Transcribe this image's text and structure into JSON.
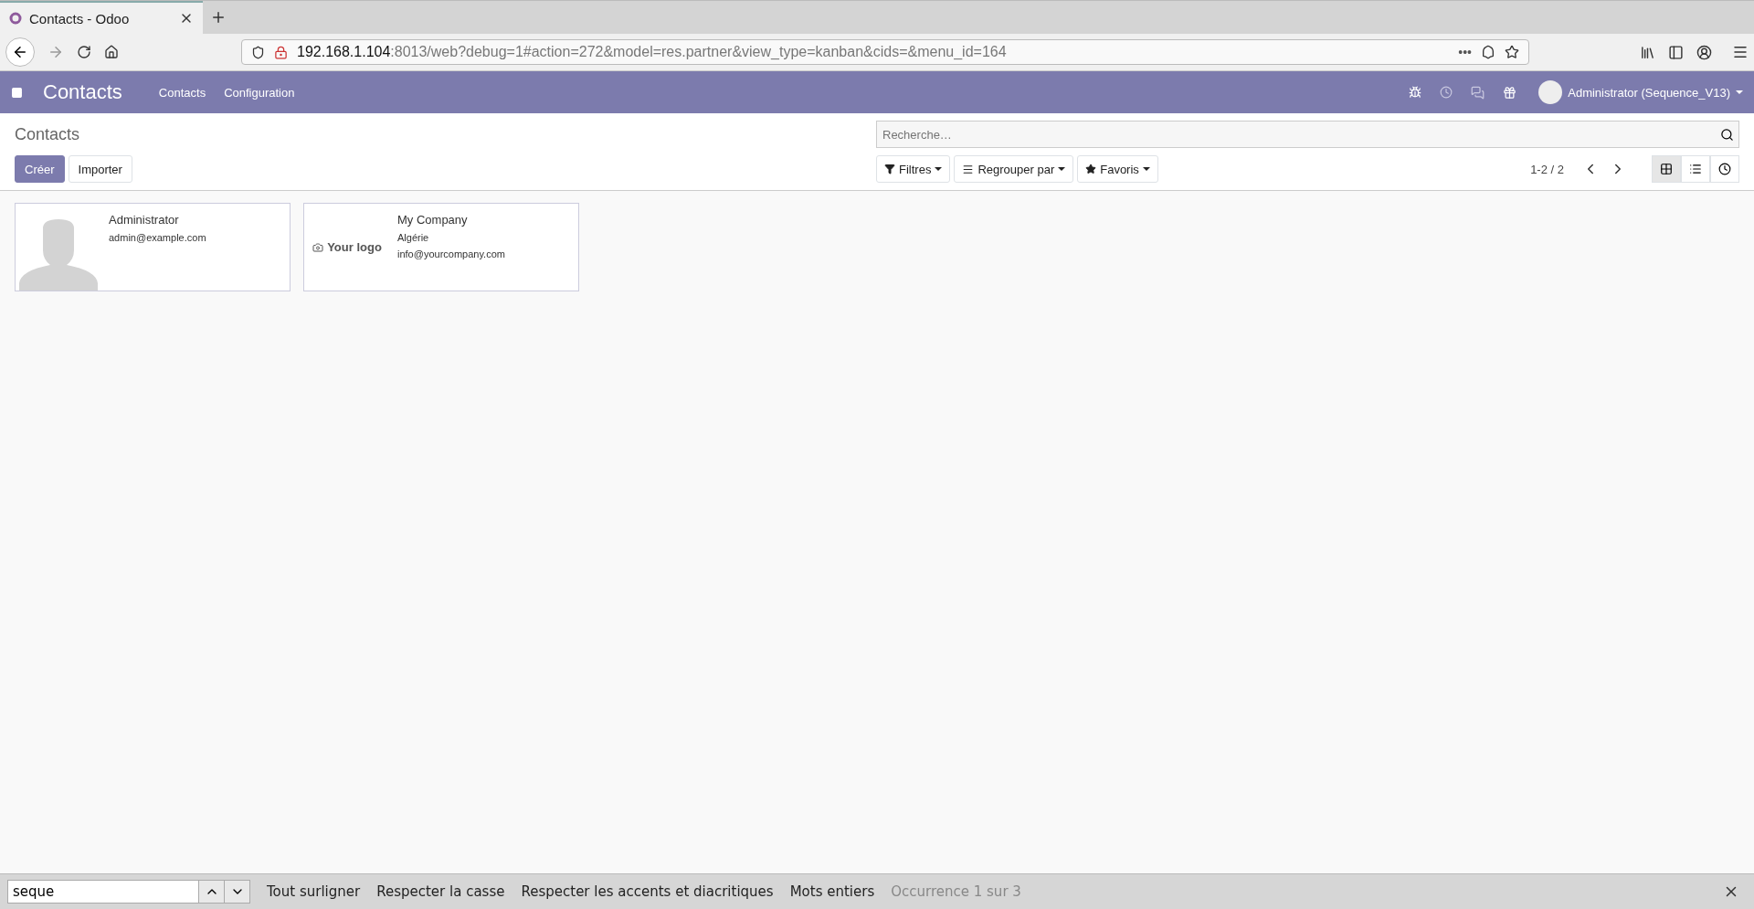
{
  "browser": {
    "tab": {
      "title": "Contacts - Odoo"
    },
    "url": {
      "host": "192.168.1.104",
      "rest": ":8013/web?debug=1#action=272&model=res.partner&view_type=kanban&cids=&menu_id=164"
    },
    "page_actions": "•••"
  },
  "navbar": {
    "app_title": "Contacts",
    "menu": [
      "Contacts",
      "Configuration"
    ],
    "user": "Administrator (Sequence_V13)"
  },
  "control_panel": {
    "breadcrumb": "Contacts",
    "buttons": [
      {
        "label": "Créer",
        "kind": "primary"
      },
      {
        "label": "Importer",
        "kind": "secondary"
      }
    ],
    "search": {
      "placeholder": "Recherche…"
    },
    "filters": [
      {
        "label": "Filtres",
        "kind": "filter"
      },
      {
        "label": "Regrouper par",
        "kind": "group"
      },
      {
        "label": "Favoris",
        "kind": "star"
      }
    ],
    "pager": "1-2 / 2",
    "views": [
      {
        "kind": "kanban",
        "selected": true
      },
      {
        "kind": "list",
        "selected": false
      },
      {
        "kind": "activity",
        "selected": false
      }
    ]
  },
  "cards": [
    {
      "kind": "person",
      "name": "Administrator",
      "lines": [
        "admin@example.com"
      ]
    },
    {
      "kind": "company",
      "logo_text": "Your logo",
      "name": "My Company",
      "lines": [
        "Algérie",
        "info@yourcompany.com"
      ]
    }
  ],
  "find_bar": {
    "value": "seque",
    "options": [
      "Tout surligner",
      "Respecter la casse",
      "Respecter les accents et diacritiques",
      "Mots entiers"
    ],
    "status": "Occurrence 1 sur 3"
  }
}
